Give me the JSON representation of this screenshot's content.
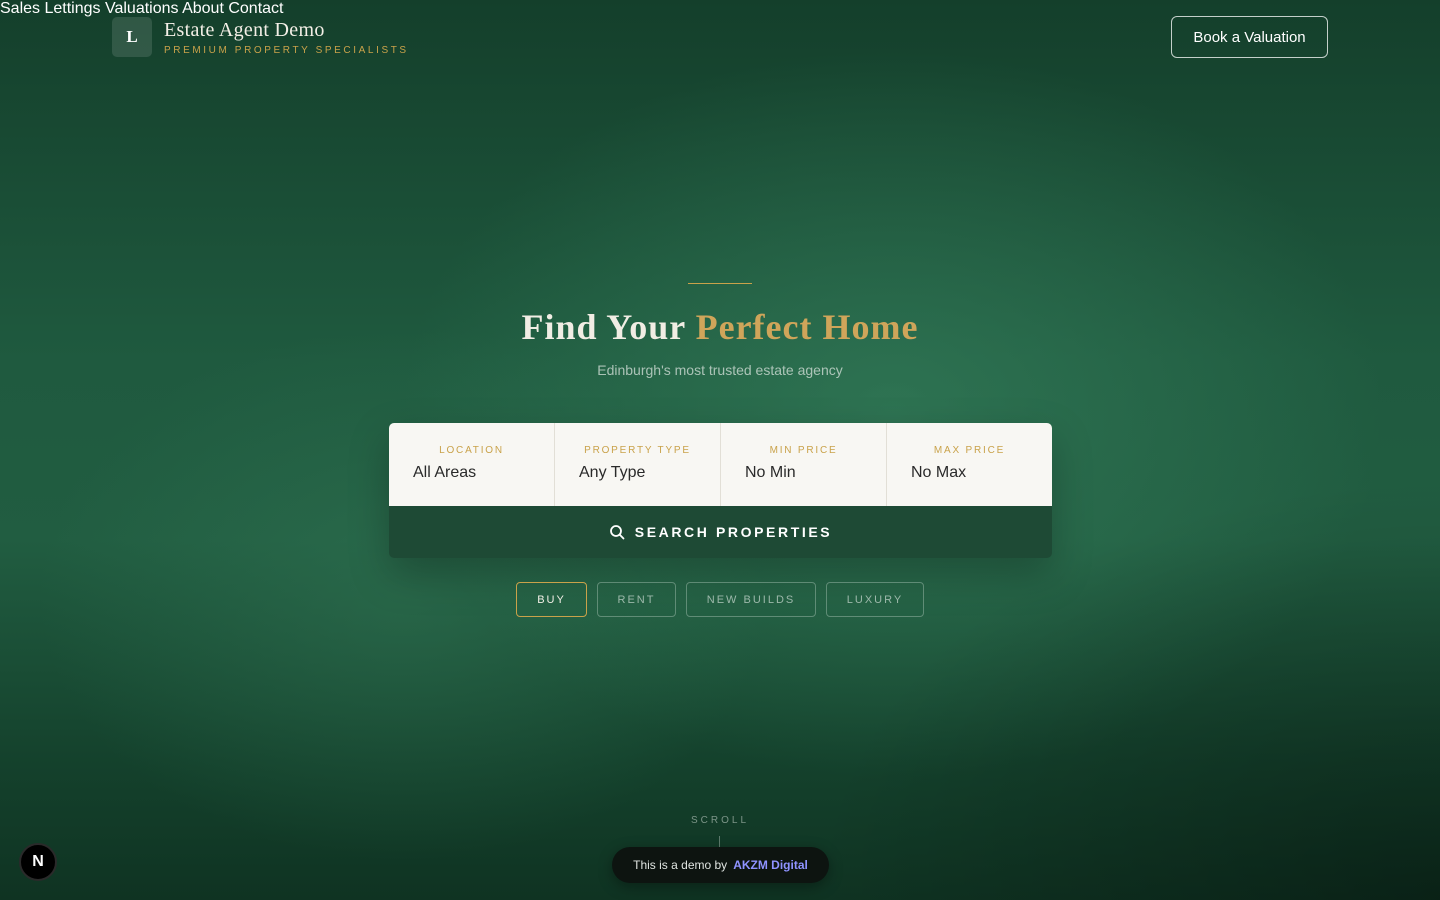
{
  "header": {
    "logo_letter": "L",
    "brand_title": "Estate Agent Demo",
    "brand_tagline": "PREMIUM PROPERTY SPECIALISTS",
    "nav": [
      "Sales",
      "Lettings",
      "Valuations",
      "About",
      "Contact"
    ],
    "cta_label": "Book a Valuation"
  },
  "hero": {
    "title_part1": "Find Your",
    "title_accent": "Perfect Home",
    "subtitle": "Edinburgh's most trusted estate agency"
  },
  "search": {
    "fields": [
      {
        "label": "LOCATION",
        "value": "All Areas"
      },
      {
        "label": "PROPERTY TYPE",
        "value": "Any Type"
      },
      {
        "label": "MIN PRICE",
        "value": "No Min"
      },
      {
        "label": "MAX PRICE",
        "value": "No Max"
      }
    ],
    "button_label": "SEARCH PROPERTIES"
  },
  "chips": [
    "BUY",
    "RENT",
    "NEW BUILDS",
    "LUXURY"
  ],
  "scroll_label": "SCROLL",
  "demo": {
    "text": "This is a demo by",
    "link": "AKZM Digital"
  },
  "n_badge": "N",
  "colors": {
    "accent_gold": "#c9a24a",
    "primary_green": "#1e4a35"
  }
}
